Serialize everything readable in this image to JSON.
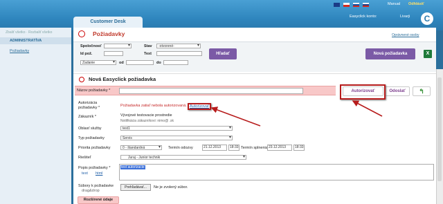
{
  "header": {
    "tab": "Customer Desk",
    "manual": "Manual",
    "logout": "Odhlásiť",
    "konto_label": "Easyclick konto:",
    "konto_user": "Livarji",
    "logo": "C",
    "flags": [
      "#1b3c87",
      "#d52b1e",
      "#0b4ea2",
      "#1b3c87",
      "#d52b1e"
    ]
  },
  "sidebar": {
    "links": "Zbaliť všetko  ·  Rozbaliť všetko",
    "section": "ADMINISTRATÍVA",
    "item": "Požiadavky"
  },
  "page": {
    "title": "Požiadavky",
    "opravnenie": "Oprávnené osoby"
  },
  "filter": {
    "spolocnost": "Spoločnosť",
    "stav": "Stav",
    "stav_value": "-otvorené-",
    "id_poz": "Id pož.",
    "text": "Text",
    "zadanie": "Zadanie",
    "od": "od",
    "do": "do",
    "hladat": "Hľadať",
    "nova": "Nová požiadavka",
    "excel": "X"
  },
  "form": {
    "title": "Nová Easyclick požiadavka",
    "nazov_label": "Názov požiadavky *",
    "autorizovat": "Autorizovať",
    "odoslat": "Odoslať",
    "back": "↰",
    "autorizacia_label1": "Autorizácia",
    "autorizacia_label2": "požiadavky *",
    "autor_text": "Požiadavka zatiaľ nebola autorizovaná.",
    "autor_link": "Autorizovať",
    "zakaznik_label": "Zákazník *",
    "zakaznik_value": "Vývojové testovacie prostredie",
    "zakaznik_sub": "Notifikácia zákazníkovi: nimo@     .sk",
    "oblast_label": "Oblasť služby",
    "oblast_value": "test1",
    "typ_label": "Typ požiadavky",
    "typ_value": "Servis",
    "priorita_label": "Priorita požiadavky",
    "priorita_value": "0 - štandardná",
    "termin_odozvy_label": "Termín odozvy",
    "termin_odozvy_date": "21.12.2013",
    "termin_odozvy_time": "18:33",
    "termin_splnenia_label": "Termín splnenia",
    "termin_splnenia_date": "23.12.2013",
    "termin_splnenia_time": "18:33",
    "riesitel_label": "Riešiteľ",
    "riesitel_value": "Juraj - Junior technik",
    "popis_label1": "Popis požiadavky *",
    "popis_text": "text",
    "popis_html": "html",
    "popis_value": "test autorizacie",
    "subory_label1": "Súbory k požiadavke",
    "subory_label2": "drag&drop",
    "browse": "Prehľadávať...",
    "no_file": "Ne je zvolený súbor.",
    "rozsirene": "Rozšírené údaje"
  }
}
